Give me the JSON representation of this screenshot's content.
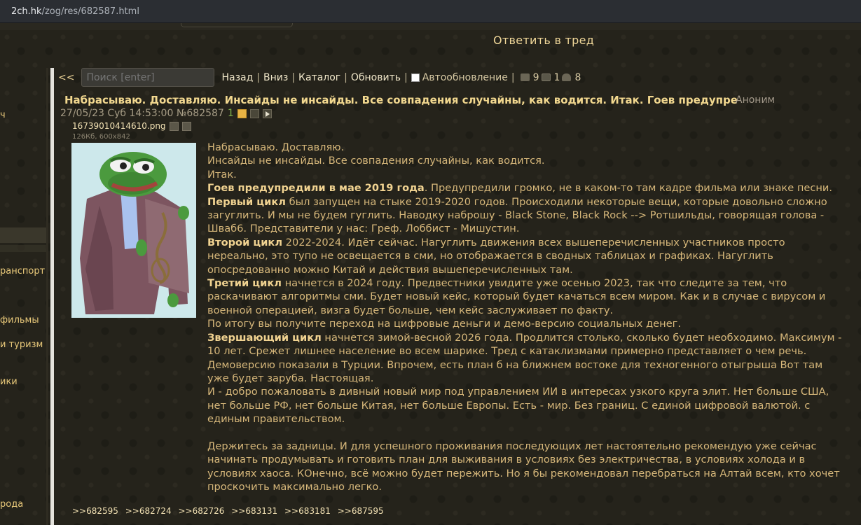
{
  "browser": {
    "url_host": "2ch.hk",
    "url_path": "/zog/res/682587.html"
  },
  "header": {
    "reply_link": "Ответить в тред"
  },
  "sidebar": {
    "items": [
      "ч",
      "ранспорт",
      "фильмы",
      "и туризм",
      "ики",
      "рода"
    ]
  },
  "nav": {
    "arrows": "<<",
    "search_placeholder": "Поиск [enter]",
    "back": "Назад",
    "down": "Вниз",
    "catalog": "Каталог",
    "refresh": "Обновить",
    "autoupdate": "Автообновление",
    "posts_count": "9",
    "images_count": "1",
    "posters_count": "8"
  },
  "post": {
    "title": "Набрасываю. Доставляю. Инсайды не инсайды. Все совпадения случайны, как водится. Итак. Гоев предупре",
    "author": "Аноним",
    "datetime": "27/05/23 Суб 14:53:00",
    "number": "№682587",
    "index": "1",
    "file": {
      "name": "16739010414610.png",
      "info": "126Кб, 600x842"
    },
    "body": {
      "l1": "Набрасываю. Доставляю.",
      "l2": "Инсайды не инсайды. Все совпадения случайны, как водится.",
      "l3": "Итак.",
      "l4b": "Гоев предупредили в мае 2019 года",
      "l4": ". Предупредили громко, не в каком-то там кадре фильма или знаке песни.",
      "l5b": "Первый цикл",
      "l5": " был запущен на стыке 2019-2020 годов. Происходили некоторые вещи, которые довольно сложно",
      "l6": "загуглить. И мы не будем гуглить. Наводку наброшу - Black Stone, Black Rock --> Ротшильды, говорящая голова -",
      "l7": "Шваб6. Представители у нас: Греф. Лоббист - Мишустин.",
      "l8b": "Второй цикл",
      "l8": " 2022-2024. Идёт сейчас. Нагуглить движения всех вышеперечисленных участников просто",
      "l9": "нереально, это тупо не освещается в сми, но отображается в сводных таблицах и графиках. Нагуглить",
      "l10": "опосредованно можно Китай и действия вышеперечисленных там.",
      "l11b": "Третий цикл",
      "l11": " начнется в 2024 году. Предвестники увидите уже осенью 2023, так что следите за тем, что",
      "l12": "раскачивают алгоритмы сми. Будет новый кейс, который будет качаться всем миром. Как и в случае с вирусом и",
      "l13": "военной операцией, визга будет больше, чем кейс заслуживает по факту.",
      "l14": "По итогу вы получите переход на цифровые деньги и демо-версию социальных денег.",
      "l15b": "Звершающий цикл",
      "l15": " начнется зимой-весной 2026 года. Продлится столько, сколько будет необходимо. Максимум -",
      "l16": "10 лет. Срежет лишнее население во всем шарике. Тред с катаклизмами примерно представляет о чем речь.",
      "l17": "Демоверсию показали в Турции. Впрочем, есть план б на ближнем востоке для техногенного отыгрыша Вот там",
      "l18": "уже будет заруба. Настоящая.",
      "l19": "И - добро пожаловать в дивный новый мир под управлением ИИ в интересах узкого круга элит. Нет больше США,",
      "l20": "нет больше РФ, нет больше Китая, нет больше Европы. Есть - мир. Без границ. С единой цифровой валютой. с",
      "l21": "единым правительством.",
      "l22": "Держитесь за задницы. И для успешного проживания последующих лет настоятельно рекомендую уже сейчас",
      "l23": "начинать продумывать и готовить план для выживания в условиях без электричества, в условиях холода и в",
      "l24": "условиях хаоса. КОнечно, всё можно будет пережить. Но я бы рекомендовал перебраться на Алтай всем, кто хочет",
      "l25": "проскочить максимально легко."
    },
    "replies": [
      ">>682595",
      ">>682724",
      ">>682726",
      ">>683131",
      ">>683181",
      ">>687595"
    ]
  },
  "colors": {
    "background": "#23211a",
    "accent": "#f0d799",
    "body_text": "#d6b77a"
  }
}
